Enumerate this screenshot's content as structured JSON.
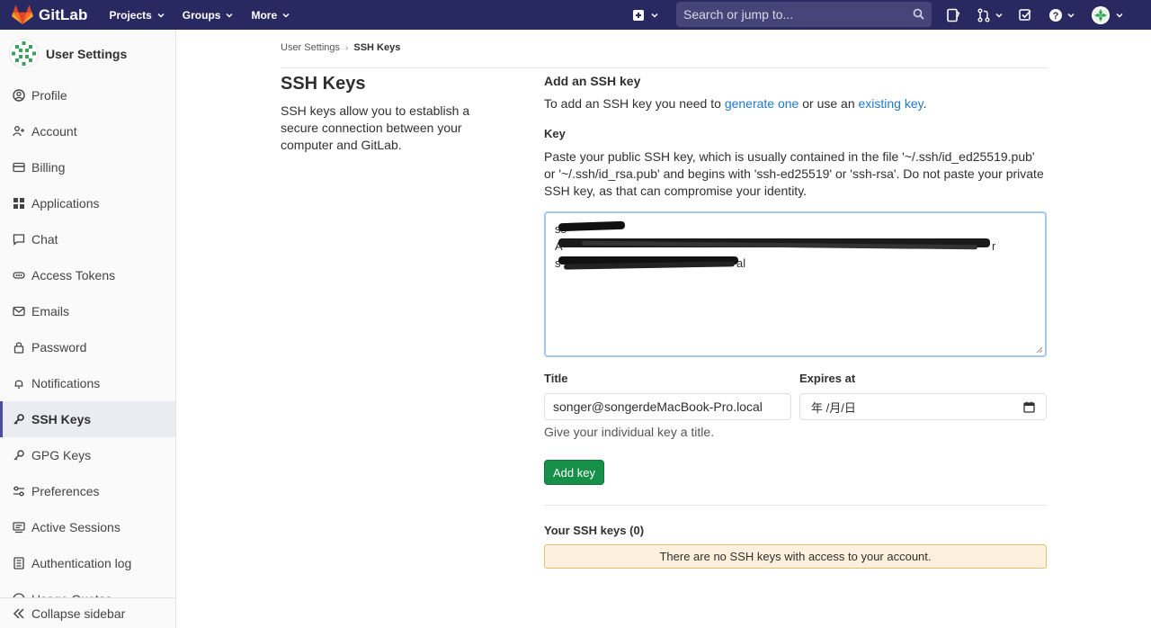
{
  "navbar": {
    "brand": "GitLab",
    "menu": [
      {
        "label": "Projects"
      },
      {
        "label": "Groups"
      },
      {
        "label": "More"
      }
    ],
    "search_placeholder": "Search or jump to...",
    "colors": {
      "background": "#292961",
      "search_bg": "#45457a"
    }
  },
  "sidebar": {
    "title": "User Settings",
    "items": [
      {
        "label": "Profile",
        "icon": "profile-icon"
      },
      {
        "label": "Account",
        "icon": "account-icon"
      },
      {
        "label": "Billing",
        "icon": "credit-card-icon"
      },
      {
        "label": "Applications",
        "icon": "applications-icon"
      },
      {
        "label": "Chat",
        "icon": "comment-icon"
      },
      {
        "label": "Access Tokens",
        "icon": "token-icon"
      },
      {
        "label": "Emails",
        "icon": "mail-icon"
      },
      {
        "label": "Password",
        "icon": "lock-icon"
      },
      {
        "label": "Notifications",
        "icon": "bell-icon"
      },
      {
        "label": "SSH Keys",
        "icon": "key-icon",
        "active": true
      },
      {
        "label": "GPG Keys",
        "icon": "key-icon"
      },
      {
        "label": "Preferences",
        "icon": "preferences-icon"
      },
      {
        "label": "Active Sessions",
        "icon": "monitor-icon"
      },
      {
        "label": "Authentication log",
        "icon": "log-icon"
      },
      {
        "label": "Usage Quotas",
        "icon": "quota-icon"
      }
    ],
    "collapse_label": "Collapse sidebar"
  },
  "breadcrumb": {
    "parent": "User Settings",
    "separator": "›",
    "current": "SSH Keys"
  },
  "left": {
    "title": "SSH Keys",
    "description": "SSH keys allow you to establish a secure connection between your computer and GitLab."
  },
  "form": {
    "section_title": "Add an SSH key",
    "intro_prefix": "To add an SSH key you need to ",
    "intro_link1": "generate one",
    "intro_middle": " or use an ",
    "intro_link2": "existing key",
    "intro_suffix": ".",
    "key_label": "Key",
    "key_help": "Paste your public SSH key, which is usually contained in the file '~/.ssh/id_ed25519.pub' or '~/.ssh/id_rsa.pub' and begins with 'ssh-ed25519' or 'ssh-rsa'. Do not paste your private SSH key, as that can compromise your identity.",
    "key_value_lines": [
      "ss",
      "A",
      "s"
    ],
    "key_value_fragments": {
      "line2_end": "r",
      "line3_end": "al"
    },
    "title_label": "Title",
    "title_value": "songer@songerdeMacBook-Pro.local",
    "title_help": "Give your individual key a title.",
    "expires_label": "Expires at",
    "expires_placeholder": "年 /月/日",
    "submit_label": "Add key"
  },
  "keys_list": {
    "title": "Your SSH keys (0)",
    "empty_message": "There are no SSH keys with access to your account."
  }
}
